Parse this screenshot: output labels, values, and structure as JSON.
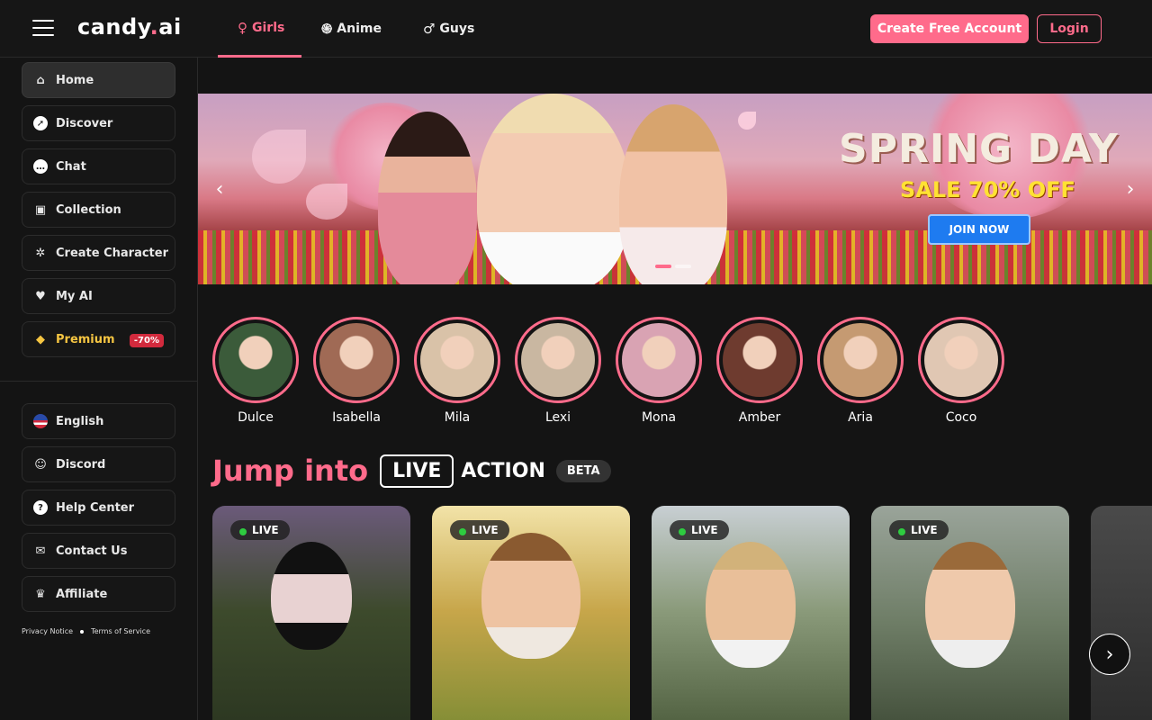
{
  "header": {
    "logo_main": "candy",
    "logo_dot": ".",
    "logo_suffix": "ai",
    "tabs": [
      {
        "label": "Girls",
        "icon": "female-icon"
      },
      {
        "label": "Anime",
        "icon": "anime-icon"
      },
      {
        "label": "Guys",
        "icon": "male-icon"
      }
    ],
    "create_account": "Create Free Account",
    "login": "Login"
  },
  "sidebar": {
    "items": [
      {
        "label": "Home",
        "icon": "home-icon"
      },
      {
        "label": "Discover",
        "icon": "compass-icon"
      },
      {
        "label": "Chat",
        "icon": "chat-icon"
      },
      {
        "label": "Collection",
        "icon": "collection-icon"
      },
      {
        "label": "Create Character",
        "icon": "magic-wand-icon"
      },
      {
        "label": "My AI",
        "icon": "heart-icon"
      },
      {
        "label": "Premium",
        "icon": "diamond-icon",
        "badge": "-70%"
      }
    ],
    "secondary": [
      {
        "label": "English",
        "icon": "us-flag-icon"
      },
      {
        "label": "Discord",
        "icon": "discord-icon"
      },
      {
        "label": "Help Center",
        "icon": "help-icon"
      },
      {
        "label": "Contact Us",
        "icon": "contact-icon"
      },
      {
        "label": "Affiliate",
        "icon": "trophy-icon"
      }
    ],
    "privacy": "Privacy Notice",
    "terms": "Terms of Service"
  },
  "banner": {
    "title": "SPRING DAY",
    "subtitle": "SALE 70% OFF",
    "cta": "JOIN NOW"
  },
  "stories": [
    {
      "name": "Dulce",
      "color": "#3b5b3a"
    },
    {
      "name": "Isabella",
      "color": "#a06a55"
    },
    {
      "name": "Mila",
      "color": "#d9c2a8"
    },
    {
      "name": "Lexi",
      "color": "#c9b7a1"
    },
    {
      "name": "Mona",
      "color": "#d9a3b3"
    },
    {
      "name": "Amber",
      "color": "#6e3b2f"
    },
    {
      "name": "Aria",
      "color": "#c59a72"
    },
    {
      "name": "Coco",
      "color": "#e0c7b3"
    }
  ],
  "live_section": {
    "jump": "Jump into",
    "live": "LIVE",
    "action": "ACTION",
    "beta": "BETA"
  },
  "live_cards": [
    {
      "tag": "LIVE"
    },
    {
      "tag": "LIVE"
    },
    {
      "tag": "LIVE"
    },
    {
      "tag": "LIVE"
    }
  ],
  "colors": {
    "accent": "#ff6b8b",
    "live_dot": "#2ecc40",
    "premium": "#f5c542"
  }
}
